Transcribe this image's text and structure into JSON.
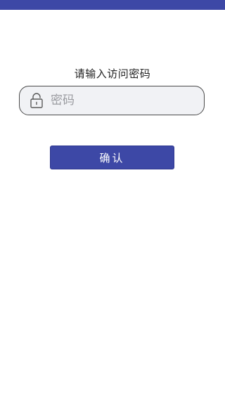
{
  "theme": {
    "accent": "#3d48a6",
    "field_background": "#f1f2f5",
    "text": "#222222"
  },
  "status_bar": {
    "icon": "status-bar"
  },
  "login": {
    "prompt": "请输入访问密码",
    "password_placeholder": "密码",
    "lock_icon": "lock-icon",
    "confirm_label": "确认"
  }
}
